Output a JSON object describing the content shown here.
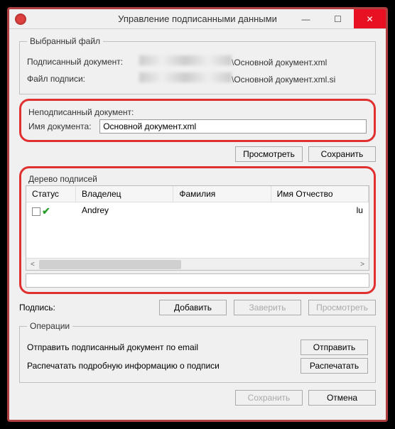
{
  "titlebar": {
    "title": "Управление подписанными данными"
  },
  "selected_file": {
    "legend": "Выбранный файл",
    "signed_doc_label": "Подписанный документ:",
    "signed_doc_suffix": "\\Основной документ.xml",
    "sig_file_label": "Файл подписи:",
    "sig_file_suffix": "\\Основной документ.xml.si"
  },
  "unsigned": {
    "legend": "Неподписанный документ:",
    "name_label": "Имя документа:",
    "name_value": "Основной документ.xml",
    "view_btn": "Просмотреть",
    "save_btn": "Сохранить"
  },
  "tree": {
    "legend": "Дерево подписей",
    "cols": {
      "status": "Статус",
      "owner": "Владелец",
      "surname": "Фамилия",
      "patronymic": "Имя Отчество"
    },
    "rows": [
      {
        "owner": "Andrey",
        "tail": "lu"
      }
    ]
  },
  "signature": {
    "label": "Подпись:",
    "add": "Добавить",
    "certify": "Заверить",
    "view": "Просмотреть"
  },
  "ops": {
    "legend": "Операции",
    "email_text": "Отправить подписанный документ по email",
    "email_btn": "Отправить",
    "print_text": "Распечатать подробную информацию о подписи",
    "print_btn": "Распечатать"
  },
  "bottom": {
    "save": "Сохранить",
    "cancel": "Отмена"
  }
}
